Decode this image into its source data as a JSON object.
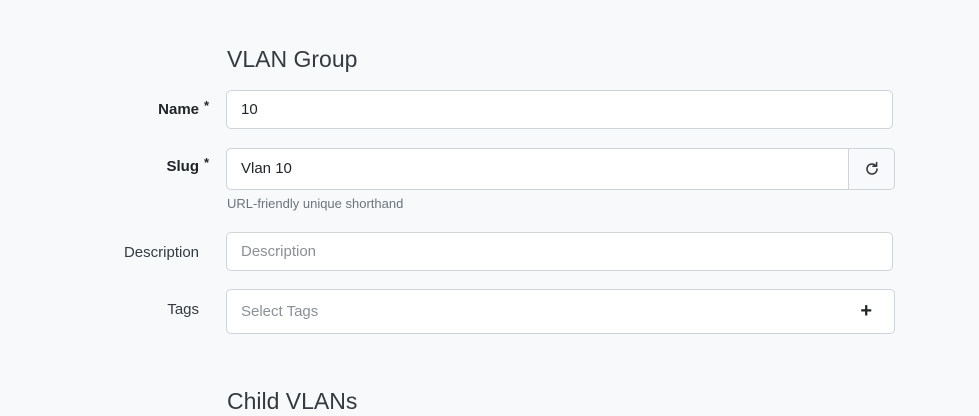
{
  "section": {
    "title": "VLAN Group",
    "next_title": "Child VLANs"
  },
  "fields": {
    "name": {
      "label": "Name",
      "required_mark": "*",
      "value": "10"
    },
    "slug": {
      "label": "Slug",
      "required_mark": "*",
      "value": "Vlan 10",
      "help": "URL-friendly unique shorthand",
      "regenerate_icon": "refresh-icon"
    },
    "description": {
      "label": "Description",
      "placeholder": "Description",
      "value": ""
    },
    "tags": {
      "label": "Tags",
      "placeholder": "Select Tags",
      "add_icon": "plus-icon",
      "add_symbol": "+"
    }
  }
}
